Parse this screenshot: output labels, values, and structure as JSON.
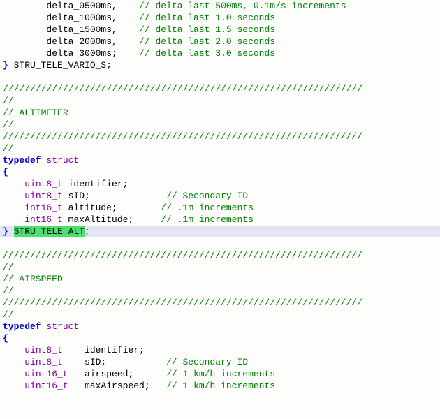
{
  "lines": [
    {
      "indent": "        ",
      "segs": [
        {
          "t": "delta_0500ms,    "
        },
        {
          "c": "cmt",
          "t": "// delta last 500ms, 0.1m/s increments"
        }
      ]
    },
    {
      "indent": "        ",
      "segs": [
        {
          "t": "delta_1000ms,    "
        },
        {
          "c": "cmt",
          "t": "// delta last 1.0 seconds"
        }
      ]
    },
    {
      "indent": "        ",
      "segs": [
        {
          "t": "delta_1500ms,    "
        },
        {
          "c": "cmt",
          "t": "// delta last 1.5 seconds"
        }
      ]
    },
    {
      "indent": "        ",
      "segs": [
        {
          "t": "delta_2000ms,    "
        },
        {
          "c": "cmt",
          "t": "// delta last 2.0 seconds"
        }
      ]
    },
    {
      "indent": "        ",
      "segs": [
        {
          "t": "delta_3000ms;    "
        },
        {
          "c": "cmt",
          "t": "// delta last 3.0 seconds"
        }
      ]
    },
    {
      "indent": "",
      "segs": [
        {
          "c": "kw",
          "t": "}"
        },
        {
          "t": " STRU_TELE_VARIO_S;"
        }
      ]
    },
    {
      "indent": "",
      "segs": []
    },
    {
      "indent": "",
      "segs": [
        {
          "c": "cmt",
          "t": "//////////////////////////////////////////////////////////////////"
        }
      ]
    },
    {
      "indent": "",
      "segs": [
        {
          "c": "cmt",
          "t": "//"
        }
      ]
    },
    {
      "indent": "",
      "segs": [
        {
          "c": "cmt",
          "t": "// ALTIMETER"
        }
      ]
    },
    {
      "indent": "",
      "segs": [
        {
          "c": "cmt",
          "t": "//"
        }
      ]
    },
    {
      "indent": "",
      "segs": [
        {
          "c": "cmt",
          "t": "//////////////////////////////////////////////////////////////////"
        }
      ]
    },
    {
      "indent": "",
      "segs": [
        {
          "c": "cmt",
          "t": "//"
        }
      ]
    },
    {
      "indent": "",
      "segs": [
        {
          "c": "kw",
          "t": "typedef"
        },
        {
          "t": " "
        },
        {
          "c": "type",
          "t": "struct"
        }
      ]
    },
    {
      "indent": "",
      "segs": [
        {
          "c": "kw",
          "t": "{"
        }
      ]
    },
    {
      "indent": "    ",
      "segs": [
        {
          "c": "type",
          "t": "uint8_t"
        },
        {
          "t": " identifier;"
        }
      ]
    },
    {
      "indent": "    ",
      "segs": [
        {
          "c": "type",
          "t": "uint8_t"
        },
        {
          "t": " sID;              "
        },
        {
          "c": "cmt",
          "t": "// Secondary ID"
        }
      ]
    },
    {
      "indent": "    ",
      "segs": [
        {
          "c": "type",
          "t": "int16_t"
        },
        {
          "t": " altitude;        "
        },
        {
          "c": "cmt",
          "t": "// .1m increments"
        }
      ]
    },
    {
      "indent": "    ",
      "segs": [
        {
          "c": "type",
          "t": "int16_t"
        },
        {
          "t": " maxAltitude;     "
        },
        {
          "c": "cmt",
          "t": "// .1m increments"
        }
      ]
    },
    {
      "indent": "",
      "hl": true,
      "segs": [
        {
          "c": "kw",
          "t": "}"
        },
        {
          "t": " "
        },
        {
          "c": "sel",
          "t": "STRU_TELE_ALT"
        },
        {
          "t": ";"
        }
      ]
    },
    {
      "indent": "",
      "segs": []
    },
    {
      "indent": "",
      "segs": [
        {
          "c": "cmt",
          "t": "//////////////////////////////////////////////////////////////////"
        }
      ]
    },
    {
      "indent": "",
      "segs": [
        {
          "c": "cmt",
          "t": "//"
        }
      ]
    },
    {
      "indent": "",
      "segs": [
        {
          "c": "cmt",
          "t": "// AIRSPEED"
        }
      ]
    },
    {
      "indent": "",
      "segs": [
        {
          "c": "cmt",
          "t": "//"
        }
      ]
    },
    {
      "indent": "",
      "segs": [
        {
          "c": "cmt",
          "t": "//////////////////////////////////////////////////////////////////"
        }
      ]
    },
    {
      "indent": "",
      "segs": [
        {
          "c": "cmt",
          "t": "//"
        }
      ]
    },
    {
      "indent": "",
      "segs": [
        {
          "c": "kw",
          "t": "typedef"
        },
        {
          "t": " "
        },
        {
          "c": "type",
          "t": "struct"
        }
      ]
    },
    {
      "indent": "",
      "segs": [
        {
          "c": "kw",
          "t": "{"
        }
      ]
    },
    {
      "indent": "    ",
      "segs": [
        {
          "c": "type",
          "t": "uint8_t"
        },
        {
          "t": "    identifier;"
        }
      ]
    },
    {
      "indent": "    ",
      "segs": [
        {
          "c": "type",
          "t": "uint8_t"
        },
        {
          "t": "    sID;           "
        },
        {
          "c": "cmt",
          "t": "// Secondary ID"
        }
      ]
    },
    {
      "indent": "    ",
      "segs": [
        {
          "c": "type",
          "t": "uint16_t"
        },
        {
          "t": "   airspeed;      "
        },
        {
          "c": "cmt",
          "t": "// 1 km/h increments"
        }
      ]
    },
    {
      "indent": "    ",
      "segs": [
        {
          "c": "type",
          "t": "uint16_t"
        },
        {
          "t": "   maxAirspeed;   "
        },
        {
          "c": "cmt",
          "t": "// 1 km/h increments"
        }
      ]
    }
  ]
}
